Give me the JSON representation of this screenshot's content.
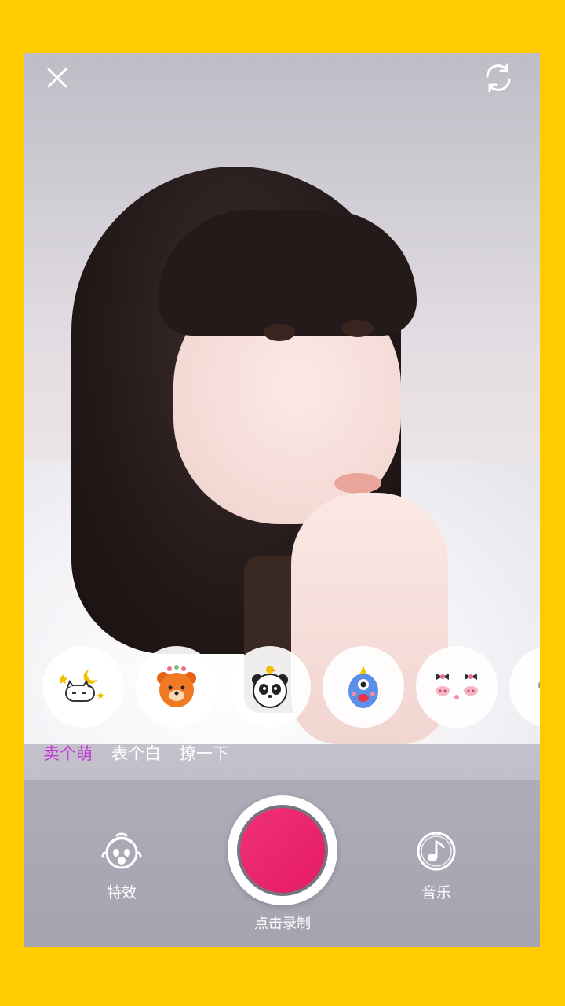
{
  "top_bar": {
    "close_icon": "close-icon",
    "flip_icon": "camera-flip-icon"
  },
  "stickers": [
    {
      "name": "sleeping-cat-moon",
      "icon": "cat-moon-sticker"
    },
    {
      "name": "orange-bear-flowers",
      "icon": "bear-sticker"
    },
    {
      "name": "panda-chick",
      "icon": "panda-sticker"
    },
    {
      "name": "blue-cyclops-monster",
      "icon": "monster-sticker"
    },
    {
      "name": "pink-pig-faces",
      "icon": "pig-sticker"
    }
  ],
  "categories": [
    {
      "label": "卖个萌",
      "active": true
    },
    {
      "label": "表个白",
      "active": false
    },
    {
      "label": "撩一下",
      "active": false
    }
  ],
  "controls": {
    "effects_label": "特效",
    "record_label": "点击录制",
    "music_label": "音乐"
  },
  "colors": {
    "frame": "#FFCC00",
    "record": "#E91E63",
    "active_category": "#C23BD4"
  }
}
